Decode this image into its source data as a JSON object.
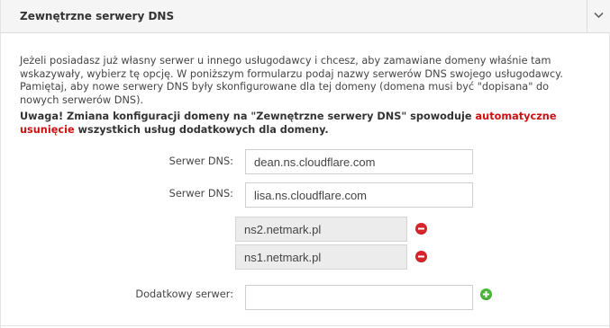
{
  "panel": {
    "title": "Zewnętrzne serwery DNS",
    "toggle_icon": "chevron-down-icon"
  },
  "description": "Jeżeli posiadasz już własny serwer u innego usługodawcy i chcesz, aby zamawiane domeny właśnie tam wskazywały, wybierz tę opcję. W poniższym formularzu podaj nazwy serwerów DNS swojego usługodawcy. Pamiętaj, aby nowe serwery DNS były skonfigurowane dla tej domeny (domena musi być \"dopisana\" do nowych serwerów DNS).",
  "warning": {
    "prefix": "Uwaga! Zmiana konfiguracji domeny na \"Zewnętrzne serwery DNS\" spowoduje ",
    "highlight": "automatyczne usunięcie",
    "suffix": " wszystkich usług dodatkowych dla domeny.",
    "highlight_color": "#cc1111"
  },
  "dns_fields": [
    {
      "label": "Serwer DNS:",
      "value": "dean.ns.cloudflare.com"
    },
    {
      "label": "Serwer DNS:",
      "value": "lisa.ns.cloudflare.com"
    }
  ],
  "existing_servers": [
    {
      "value": "ns2.netmark.pl",
      "action_icon": "minus-circle-icon"
    },
    {
      "value": "ns1.netmark.pl",
      "action_icon": "minus-circle-icon"
    }
  ],
  "additional": {
    "label": "Dodatkowy serwer:",
    "value": "",
    "action_icon": "plus-circle-icon"
  },
  "colors": {
    "remove": "#d9232a",
    "add": "#4bb53a",
    "header_bg": "#f5f5f5"
  }
}
